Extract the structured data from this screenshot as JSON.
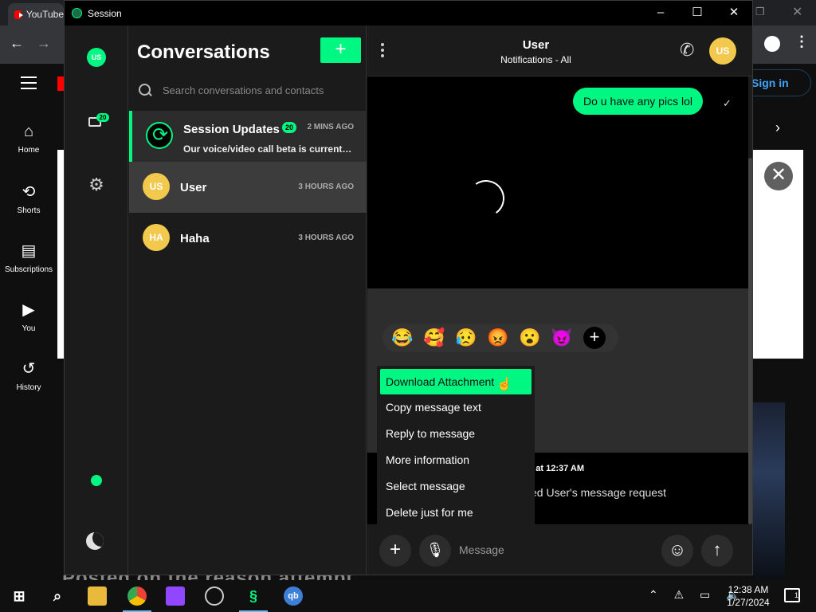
{
  "browser": {
    "tab_title": "YouTube",
    "signin_label": "Sign in",
    "sidebar": [
      {
        "icon": "home-icon",
        "label": "Home"
      },
      {
        "icon": "shorts-icon",
        "label": "Shorts"
      },
      {
        "icon": "subscriptions-icon",
        "label": "Subscriptions"
      },
      {
        "icon": "you-icon",
        "label": "You"
      },
      {
        "icon": "history-icon",
        "label": "History"
      }
    ],
    "video_caption": "Posted on the reason attempt"
  },
  "window": {
    "title": "Session"
  },
  "rail": {
    "avatar_initials": "US",
    "unread_badge": "20"
  },
  "conversations": {
    "title": "Conversations",
    "new_button": "+",
    "search_placeholder": "Search conversations and contacts",
    "items": [
      {
        "name": "Session Updates",
        "badge": "20",
        "time": "2 MINS AGO",
        "preview": "Our voice/video call beta is currently available"
      },
      {
        "name": "User",
        "initials": "US",
        "time": "3 HOURS AGO"
      },
      {
        "name": "Haha",
        "initials": "HA",
        "time": "3 HOURS AGO"
      }
    ]
  },
  "chat": {
    "name": "User",
    "subtitle": "Notifications - All",
    "header_initials": "US",
    "sent_message": "Do u have any pics lol",
    "info_date": "ay at 12:37 AM",
    "info_text": "ed User's message request",
    "reactions": [
      "😂",
      "🥰",
      "😥",
      "😡",
      "😮",
      "😈"
    ],
    "reaction_more": "+",
    "context_menu": [
      "Download Attachment",
      "Copy message text",
      "Reply to message",
      "More information",
      "Select message",
      "Delete just for me"
    ],
    "composer_placeholder": "Message"
  },
  "taskbar": {
    "time": "12:38 AM",
    "date": "1/27/2024",
    "notifications": "1"
  },
  "colors": {
    "accent": "#00f782",
    "avatar_yellow": "#f2c94c"
  }
}
